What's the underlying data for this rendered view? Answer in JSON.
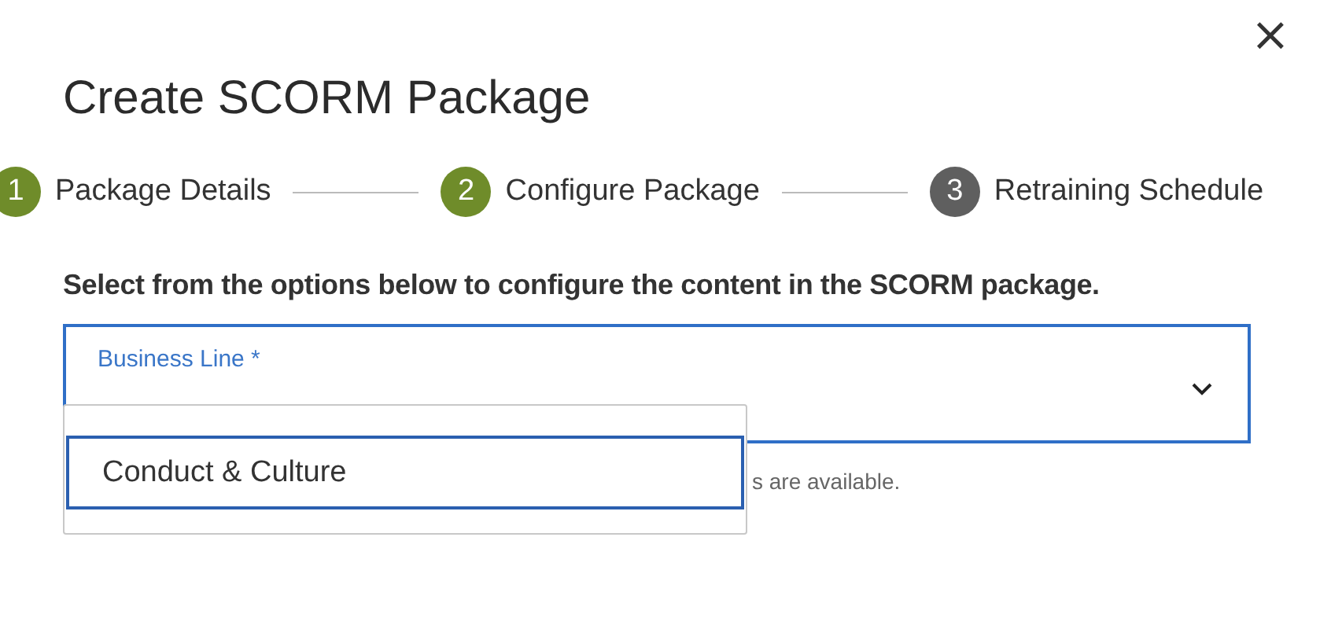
{
  "dialog": {
    "title": "Create SCORM Package",
    "close": "×"
  },
  "steps": [
    {
      "number": "1",
      "label": "Package Details",
      "active": true
    },
    {
      "number": "2",
      "label": "Configure Package",
      "active": true
    },
    {
      "number": "3",
      "label": "Retraining Schedule",
      "active": false
    }
  ],
  "instruction": "Select from the options below to configure the content in the SCORM package.",
  "select": {
    "label": "Business Line *",
    "expanded": true,
    "helper": "s are available.",
    "options": [
      {
        "label": "Conduct & Culture",
        "selected": true
      }
    ]
  }
}
